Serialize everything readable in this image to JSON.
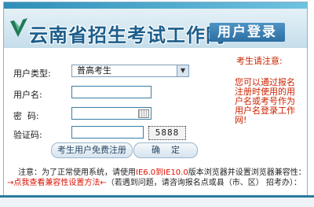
{
  "header": {
    "site_title": "云南省招生考试工作网",
    "login_title": "用户登录"
  },
  "form": {
    "user_type_label": "用户类型:",
    "user_type_value": "普高考生",
    "username_label": "用户名:",
    "password_label": "密  码:",
    "captcha_label": "验证码:",
    "captcha_value": "5888"
  },
  "buttons": {
    "register": "考生用户免费注册",
    "confirm": "确    定"
  },
  "notice": {
    "title": "考生请注意:",
    "body": "您可以通过报名注册时使用的用户名或考号作为用户名登录工作网!"
  },
  "notes": {
    "line1_prefix": "注意：为了正常使用系统，请使用",
    "line1_browser": "IE6.0到IE10.0",
    "line1_suffix": "版本浏览器并设置浏览器兼容性：",
    "line2_link": "→点我查看兼容性设置方法←",
    "line2_suffix": "（若遇到问题，请咨询报名点或县（市、区） 招考办）："
  },
  "colors": {
    "brand_blue": "#1c5d8a",
    "notice_red": "#cc2200",
    "border_blue": "#8fb0c8"
  }
}
